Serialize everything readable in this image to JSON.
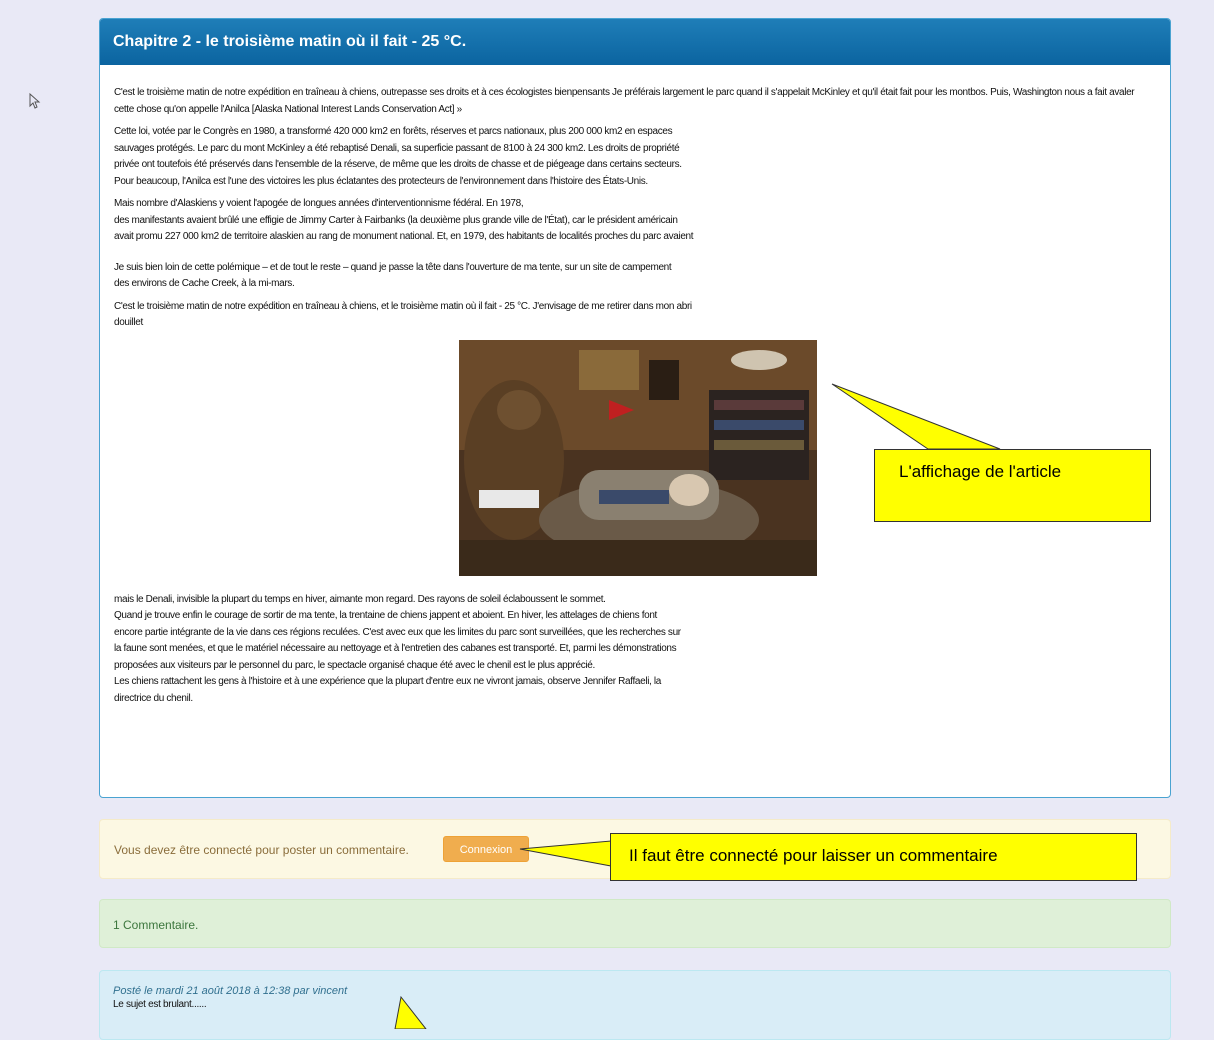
{
  "article": {
    "title": "Chapitre 2 - le troisième matin où il fait - 25 °C.",
    "paragraphs": [
      {
        "lines": [
          "C'est le troisième matin de notre expédition en traîneau à chiens, outrepasse ses droits et à ces écologistes bienpensants Je préférais largement le parc quand il s'appelait McKinley et qu'il était fait pour les montbos. Puis, Washington nous a fait avaler",
          "cette chose qu'on appelle l'Anilca [Alaska National Interest Lands Conservation Act] »"
        ]
      },
      {
        "lines": [
          "Cette loi, votée par le Congrès en 1980, a transformé 420 000 km2 en forêts, réserves et parcs nationaux, plus 200 000 km2 en espaces",
          "sauvages protégés. Le parc du mont McKinley a été rebaptisé Denali, sa superficie passant de 8100 à 24 300 km2. Les droits de propriété",
          "privée ont toutefois été préservés dans l'ensemble de la réserve, de même que les droits de chasse et de piégeage dans certains secteurs.",
          "Pour beaucoup, l'Anilca est l'une des victoires les plus éclatantes des protecteurs de l'environnement dans l'histoire des États-Unis."
        ]
      },
      {
        "lines": [
          "Mais nombre d'Alaskiens y voient l'apogée de longues années d'interventionnisme fédéral. En 1978,",
          "des manifestants avaient brûlé une effigie de Jimmy Carter à Fairbanks (la deuxième plus grande ville de l'État), car le président américain",
          "avait promu 227 000 km2 de territoire alaskien au rang de monument national. Et, en 1979, des habitants de localités proches du parc avaient"
        ]
      },
      {
        "lines": [
          "Je suis bien loin de cette polémique – et de tout le reste – quand je passe la tête dans l'ouverture de ma tente, sur un site de campement",
          "des environs de Cache Creek, à la mi-mars."
        ]
      },
      {
        "lines": [
          "C'est le troisième matin de notre expédition en traîneau à chiens, et le troisième matin où il fait - 25 °C. J'envisage de me retirer dans mon abri",
          "douillet"
        ]
      },
      {
        "lines": [
          "mais le Denali, invisible la plupart du temps en hiver, aimante mon regard. Des rayons de soleil éclaboussent le sommet.",
          "Quand je trouve enfin le courage de sortir de ma tente, la trentaine de chiens jappent et aboient. En hiver, les attelages de chiens font",
          "encore partie intégrante de la vie dans ces régions reculées. C'est avec eux que les limites du parc sont surveillées, que les recherches sur",
          "la faune sont menées, et que le matériel nécessaire au nettoyage et à l'entretien des cabanes est transporté. Et, parmi les démonstrations",
          "proposées aux visiteurs par le personnel du parc, le spectacle organisé chaque été avec le chenil est le plus apprécié.",
          "Les chiens rattachent les gens à l'histoire et à une expérience que la plupart d'entre eux ne vivront jamais, observe Jennifer Raffaeli, la",
          "directrice du chenil."
        ]
      }
    ]
  },
  "login_alert": {
    "message": "Vous devez être connecté pour poster un commentaire.",
    "button": "Connexion"
  },
  "comments": {
    "count_label": "1 Commentaire.",
    "items": [
      {
        "meta": "Posté le mardi 21 août 2018 à 12:38 par vincent",
        "text": "Le sujet est brulant......"
      }
    ]
  },
  "callouts": {
    "article": "L'affichage de l'article",
    "comment": "Il faut être connecté pour laisser un commentaire"
  },
  "colors": {
    "header": "#0b64a0",
    "callout": "#ffff00",
    "login_button": "#f0ad4e"
  }
}
